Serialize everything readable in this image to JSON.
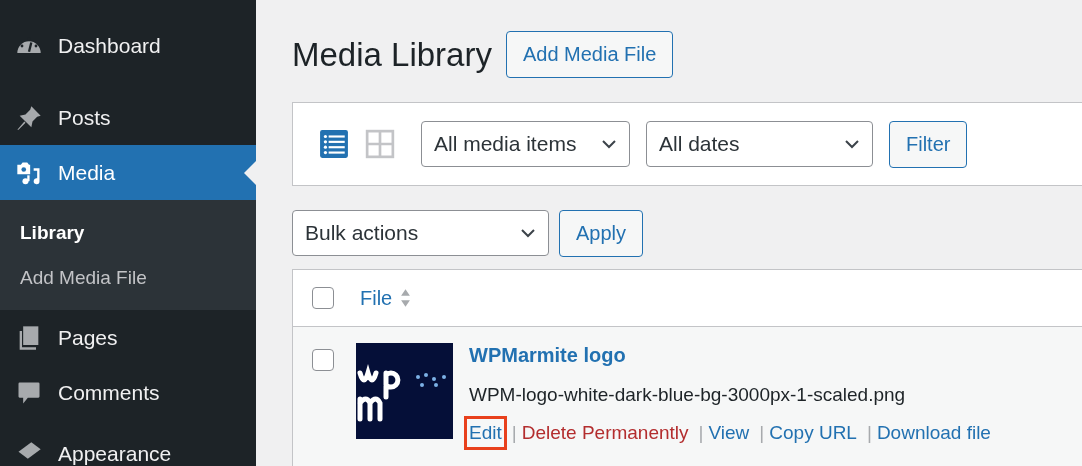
{
  "sidebar": {
    "items": [
      {
        "label": "Dashboard",
        "selected": false
      },
      {
        "label": "Posts",
        "selected": false
      },
      {
        "label": "Media",
        "selected": true,
        "children": [
          {
            "label": "Library",
            "selected": true
          },
          {
            "label": "Add Media File",
            "selected": false
          }
        ]
      },
      {
        "label": "Pages",
        "selected": false
      },
      {
        "label": "Comments",
        "selected": false
      },
      {
        "label": "Appearance",
        "selected": false
      }
    ]
  },
  "page": {
    "title": "Media Library",
    "add_button": "Add Media File"
  },
  "filter_bar": {
    "views": [
      {
        "kind": "list",
        "selected": true
      },
      {
        "kind": "grid",
        "selected": false
      }
    ],
    "type_select": "All media items",
    "date_select": "All dates",
    "filter_button": "Filter"
  },
  "bulk": {
    "select": "Bulk actions",
    "apply_button": "Apply"
  },
  "table": {
    "all_checked": false,
    "columns": [
      {
        "label": "File",
        "sortable": true
      }
    ],
    "rows": [
      {
        "checked": false,
        "separator": "|",
        "title": "WPMarmite logo",
        "filename": "WPM-logo-white-dark-blue-bg-3000px-1-scaled.png",
        "actions": [
          {
            "label": "Edit",
            "kind": "link",
            "highlighted": true
          },
          {
            "label": "Delete Permanently",
            "kind": "danger",
            "highlighted": false
          },
          {
            "label": "View",
            "kind": "link",
            "highlighted": false
          },
          {
            "label": "Copy URL",
            "kind": "link",
            "highlighted": false
          },
          {
            "label": "Download file",
            "kind": "link",
            "highlighted": false
          }
        ]
      }
    ]
  }
}
